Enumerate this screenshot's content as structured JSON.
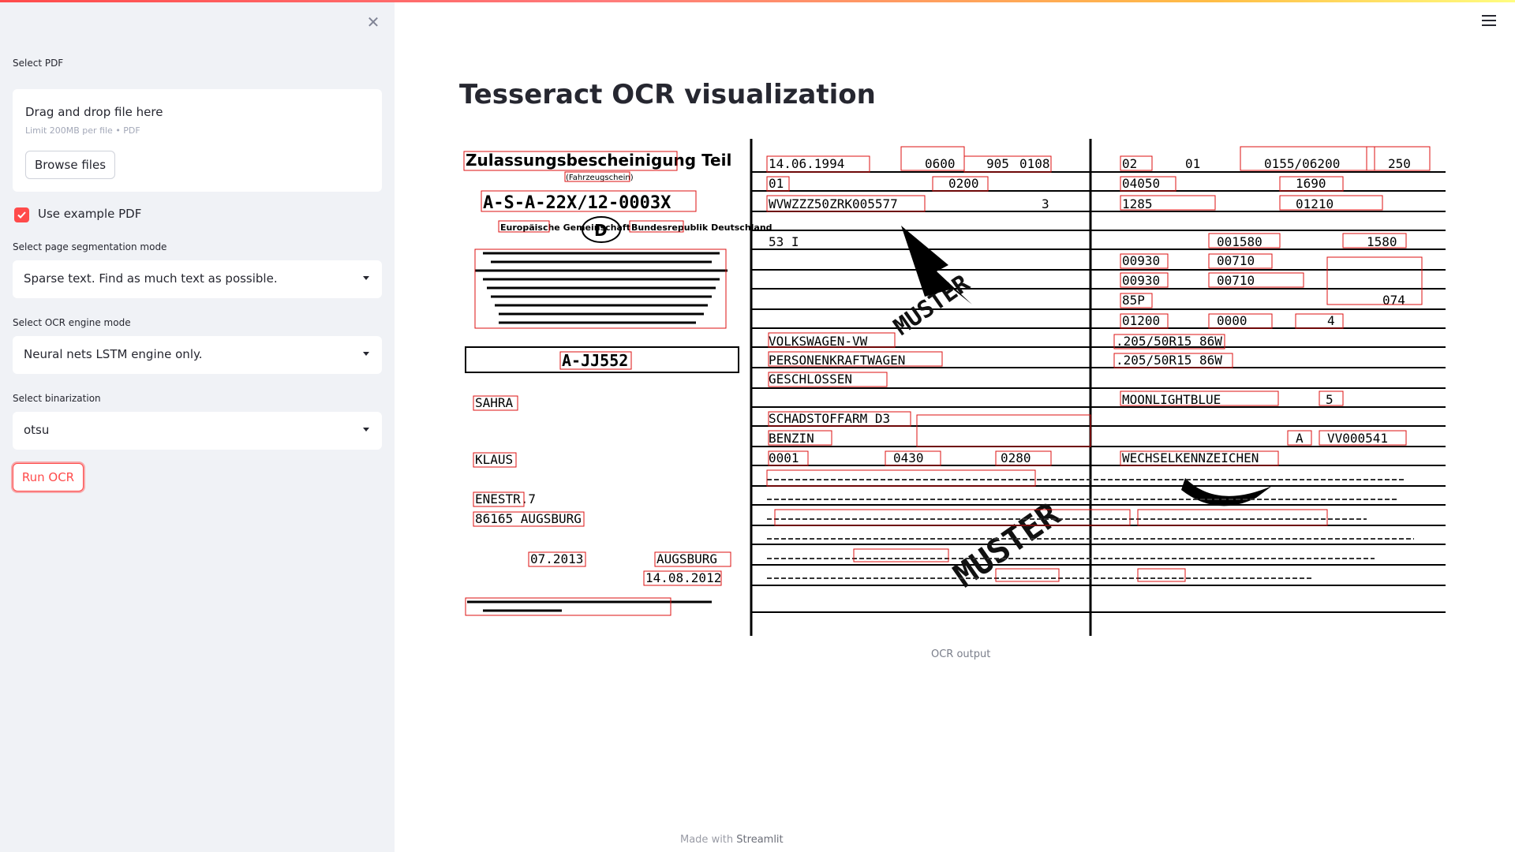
{
  "sidebar": {
    "close_icon": "close-icon",
    "select_pdf_label": "Select PDF",
    "uploader": {
      "title": "Drag and drop file here",
      "limit": "Limit 200MB per file • PDF",
      "browse_label": "Browse files"
    },
    "use_example_label": "Use example PDF",
    "use_example_checked": true,
    "psm": {
      "label": "Select page segmentation mode",
      "value": "Sparse text. Find as much text as possible."
    },
    "oem": {
      "label": "Select OCR engine mode",
      "value": "Neural nets LSTM engine only."
    },
    "binarization": {
      "label": "Select binarization",
      "value": "otsu"
    },
    "run_label": "Run OCR"
  },
  "header": {
    "menu_icon": "hamburger-menu-icon"
  },
  "main": {
    "title": "Tesseract OCR visualization",
    "image_caption": "OCR output"
  },
  "document": {
    "heading": "Zulassungsbescheinigung Teil",
    "subheading": "(Fahrzeugschein)",
    "reg_number": "A-S-A-22X/12-0003X",
    "eu_left": "Europäische Gemeinschaft",
    "country_code": "D",
    "eu_right": "Bundesrepublik Deutschland",
    "plate": "A-JJ552",
    "surname": "SAHRA",
    "firstname": "KLAUS",
    "street": "ENESTR.7",
    "city": "86165 AUGSBURG",
    "next_hu": "07.2013",
    "place": "AUGSBURG",
    "date": "14.08.2012",
    "watermark": "MUSTER",
    "fields_left": [
      "14.06.1994",
      "0600",
      "905",
      "0108",
      "01",
      "0200",
      "WVWZZZ50ZRK005577",
      "3",
      "53 I",
      "VOLKSWAGEN-VW",
      "PERSONENKRAFTWAGEN",
      "GESCHLOSSEN",
      "SCHADSTOFFARM D3",
      "BENZIN",
      "0001",
      "0430",
      "0280"
    ],
    "fields_right": [
      "02",
      "01",
      "0155/06200",
      "250",
      "04050",
      "1690",
      "1285",
      "01210",
      "001580",
      "1580",
      "00930",
      "00710",
      "00930",
      "00710",
      "85P",
      "074",
      "01200",
      "0000",
      "4",
      ".205/50R15 86W",
      ".205/50R15 86W",
      "MOONLIGHTBLUE",
      "5",
      "A",
      "VV000541",
      "WECHSELKENNZEICHEN"
    ]
  }
}
